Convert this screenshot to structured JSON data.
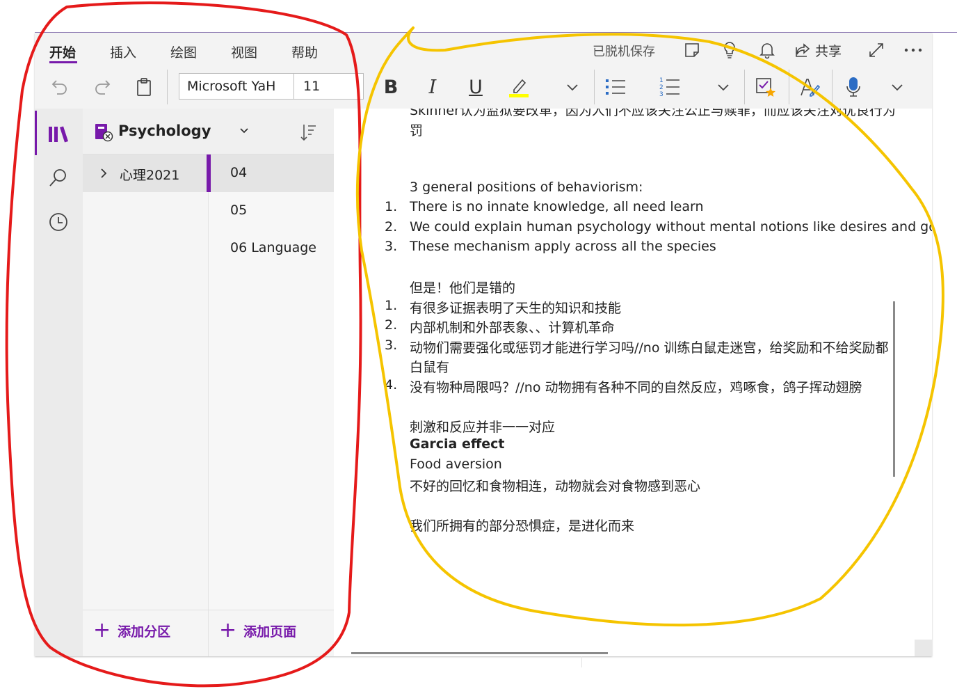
{
  "app": {
    "ribbon_tabs": [
      "开始",
      "插入",
      "绘图",
      "视图",
      "帮助"
    ],
    "active_tab": "开始",
    "status": "已脱机保存",
    "share_label": "共享",
    "accent_color": "#7719aa"
  },
  "toolbar": {
    "font_name": "Microsoft YaH",
    "font_size": "11",
    "bold_label": "B",
    "italic_label": "I",
    "underline_label": "U",
    "highlight_color": "#ffff00"
  },
  "notebook": {
    "name": "Psychology",
    "sections": [
      {
        "label": "心理2021"
      }
    ],
    "pages": [
      {
        "label": "04"
      },
      {
        "label": "05"
      },
      {
        "label": "06 Language"
      }
    ],
    "add_section": "添加分区",
    "add_page": "添加页面"
  },
  "note": {
    "partial_top_1": "Skinner认为监狱要改革，因为人们不应该关注公正与赎罪，而应该关注对优良行为",
    "partial_top_2": "罚",
    "behaviorism_heading": "3 general positions of behaviorism:",
    "behaviorism_list": [
      {
        "num": "1.",
        "text": "There is no innate knowledge, all need learn"
      },
      {
        "num": "2.",
        "text": "We could explain human psychology without mental notions like desires and goals"
      },
      {
        "num": "3.",
        "text": "These mechanism apply across all the species"
      }
    ],
    "wrong_heading": "但是！他们是错的",
    "wrong_list": [
      {
        "num": "1.",
        "text": "有很多证据表明了天生的知识和技能"
      },
      {
        "num": "2.",
        "text": "内部机制和外部表象、、计算机革命"
      },
      {
        "num": "3.",
        "text": "动物们需要强化或惩罚才能进行学习吗//no 训练白鼠走迷宫，给奖励和不给奖励都",
        "text_cont": "白鼠有"
      },
      {
        "num": "4.",
        "text": "没有物种局限吗？//no 动物拥有各种不同的自然反应，鸡啄食，鸽子挥动翅膀"
      }
    ],
    "stimulus_line": "刺激和反应并非一一对应",
    "garcia": "Garcia effect",
    "food_aversion": "Food aversion",
    "bad_memory": "不好的回忆和食物相连，动物就会对食物感到恶心",
    "phobia": "我们所拥有的部分恐惧症，是进化而来"
  },
  "annotations": {
    "red_color": "#e51a1a",
    "yellow_color": "#f5c400"
  }
}
